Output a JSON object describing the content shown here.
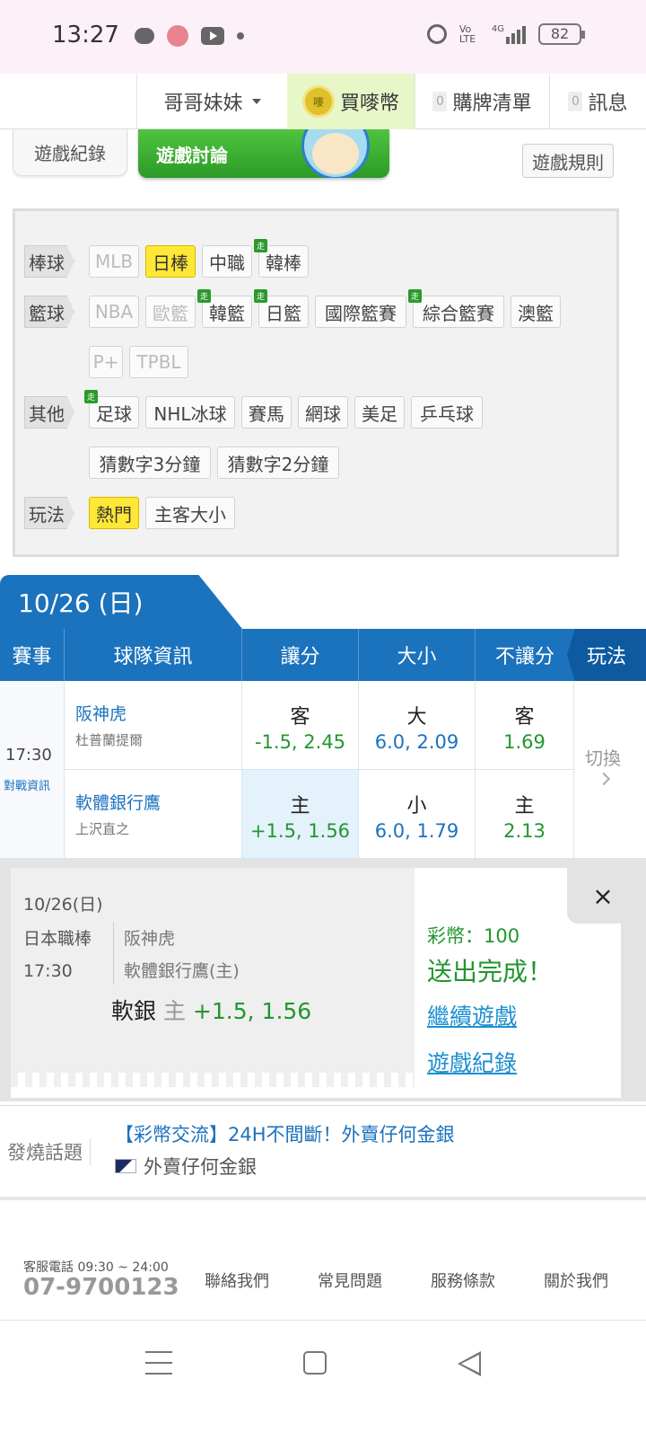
{
  "status_bar": {
    "time": "13:27",
    "battery": "82",
    "volte": "Vo LTE",
    "network": "4G"
  },
  "top_nav": {
    "user": "哥哥妹妹",
    "coin_label": "買嘜幣",
    "coin_icon_text": "嘜",
    "cart_label": "購牌清單",
    "cart_count": "0",
    "msg_label": "訊息",
    "msg_count": "0"
  },
  "tabs": {
    "record": "遊戲紀錄",
    "discuss": "遊戲討論",
    "rules": "遊戲規則"
  },
  "categories": {
    "baseball_label": "棒球",
    "baseball": [
      "MLB",
      "日棒",
      "中職",
      "韓棒"
    ],
    "basketball_label": "籃球",
    "basketball": [
      "NBA",
      "歐籃",
      "韓籃",
      "日籃",
      "國際籃賽",
      "綜合籃賽",
      "澳籃",
      "P+",
      "TPBL"
    ],
    "other_label": "其他",
    "other": [
      "足球",
      "NHL冰球",
      "賽馬",
      "網球",
      "美足",
      "乒乓球",
      "猜數字3分鐘",
      "猜數字2分鐘"
    ],
    "play_label": "玩法",
    "play": [
      "熱門",
      "主客大小"
    ],
    "walk_badge": "走"
  },
  "date_header": "10/26 (日)",
  "table": {
    "headers": [
      "賽事",
      "球隊資訊",
      "讓分",
      "大小",
      "不讓分",
      "玩法"
    ],
    "time": "17:30",
    "matchup_link": "對戰資訊",
    "switch": "切換",
    "rows": [
      {
        "team": "阪神虎",
        "pitcher": "杜普蘭提爾",
        "spread_side": "客",
        "spread": "-1.5, 2.45",
        "total_side": "大",
        "total": "6.0, 2.09",
        "ml_side": "客",
        "ml": "1.69"
      },
      {
        "team": "軟體銀行鷹",
        "pitcher": "上沢直之",
        "spread_side": "主",
        "spread": "+1.5, 1.56",
        "total_side": "小",
        "total": "6.0, 1.79",
        "ml_side": "主",
        "ml": "2.13"
      }
    ]
  },
  "confirm": {
    "date": "10/26(日)",
    "league": "日本職棒",
    "time": "17:30",
    "away": "阪神虎",
    "home": "軟體銀行鷹(主)",
    "pick_team": "軟銀",
    "pick_side": "主",
    "pick_odds": "+1.5, 1.56",
    "coins": "彩幣：100",
    "done": "送出完成！",
    "continue": "繼續遊戲",
    "records": "遊戲紀錄",
    "close": "×"
  },
  "topic": {
    "label": "發燒話題",
    "title": "【彩幣交流】24H不間斷！外賣仔何金銀",
    "user": "外賣仔何金銀"
  },
  "footer": {
    "hours": "客服電話 09:30 ~ 24:00",
    "phone": "07-9700123",
    "links": [
      "聯絡我們",
      "常見問題",
      "服務條款",
      "關於我們"
    ]
  },
  "colors": {
    "primary": "#1b72bd",
    "green": "#22962f",
    "highlight": "#ffe735"
  }
}
